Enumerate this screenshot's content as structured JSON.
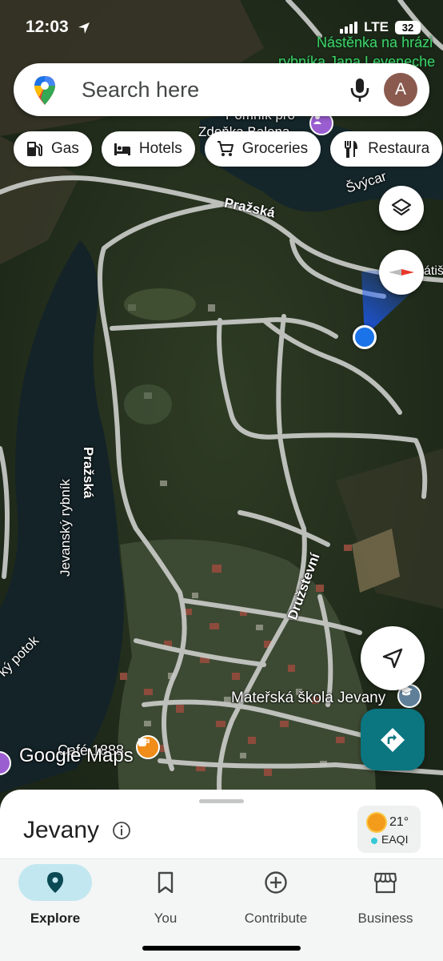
{
  "status_bar": {
    "time": "12:03",
    "network": "LTE",
    "battery": "32"
  },
  "search": {
    "placeholder": "Search here",
    "avatar_initial": "A"
  },
  "chips": [
    {
      "label": "Gas",
      "icon": "gas-station-icon"
    },
    {
      "label": "Hotels",
      "icon": "bed-icon"
    },
    {
      "label": "Groceries",
      "icon": "shopping-cart-icon"
    },
    {
      "label": "Restaura",
      "icon": "fork-knife-icon"
    }
  ],
  "map_labels": {
    "nastenka": "Nástěnka na hrázi",
    "rybnika": "rybníka Jana Leveneche",
    "pomnik": "Pomník pro",
    "zdenka": "Zdeňka Balena",
    "svycar": "Švýcar",
    "prazska_top": "Pražská",
    "prazska_side": "Pražská",
    "zatis": "átiš",
    "jevansky": "Jevanský rybník",
    "potok": "ký potok",
    "druzstevni": "Družstevní",
    "materska": "Mateřská škola Jevany",
    "cafe": "Café 1888"
  },
  "logo": "Google Maps",
  "place": {
    "title": "Jevany"
  },
  "weather": {
    "temp": "21°",
    "aqi": "EAQI"
  },
  "nav": [
    {
      "label": "Explore",
      "icon": "location-pin-icon",
      "active": true
    },
    {
      "label": "You",
      "icon": "bookmark-icon",
      "active": false
    },
    {
      "label": "Contribute",
      "icon": "add-circle-icon",
      "active": false
    },
    {
      "label": "Business",
      "icon": "storefront-icon",
      "active": false
    }
  ],
  "colors": {
    "accent_teal": "#0b7580",
    "location_blue": "#1a73e8",
    "nav_active": "#c2e7f0"
  }
}
